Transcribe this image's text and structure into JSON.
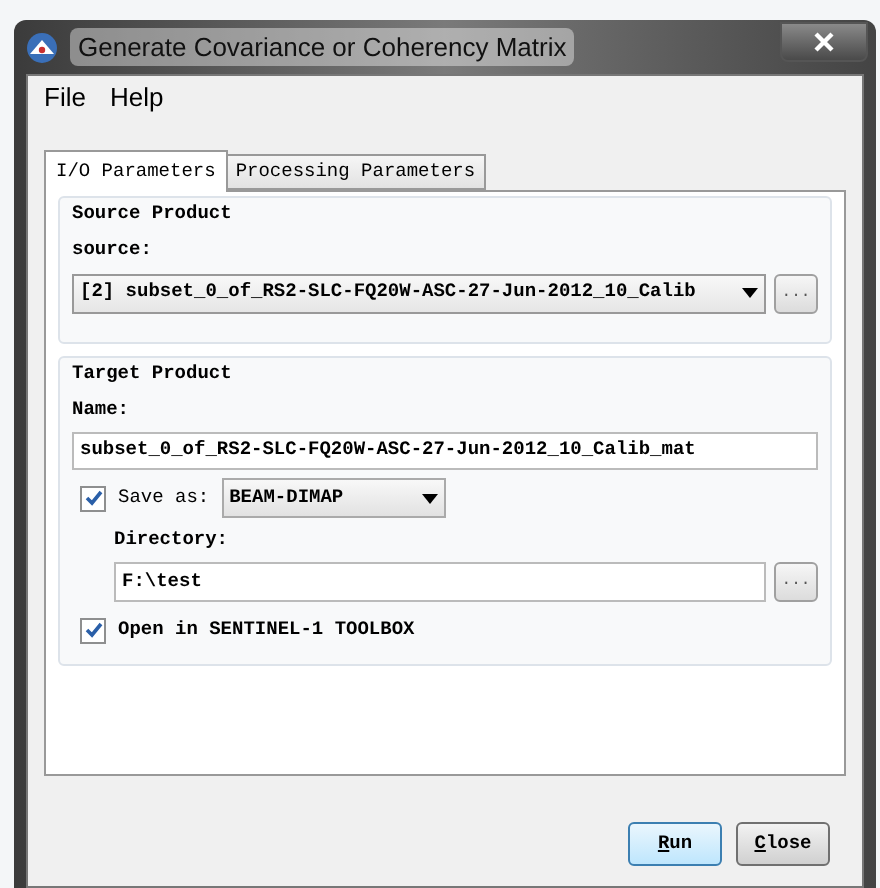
{
  "window": {
    "title": "Generate Covariance or Coherency Matrix"
  },
  "menu": [
    "File",
    "Help"
  ],
  "tabs": [
    {
      "label": "I/O Parameters",
      "selected": true
    },
    {
      "label": "Processing Parameters",
      "selected": false
    }
  ],
  "source_product": {
    "title": "Source Product",
    "label": "source:",
    "value": "[2] subset_0_of_RS2-SLC-FQ20W-ASC-27-Jun-2012_10_Calib",
    "browse": "..."
  },
  "target_product": {
    "title": "Target Product",
    "name_label": "Name:",
    "name_value": "subset_0_of_RS2-SLC-FQ20W-ASC-27-Jun-2012_10_Calib_mat",
    "save_as": {
      "label": "Save as:",
      "checked": true,
      "format": "BEAM-DIMAP"
    },
    "directory_label": "Directory:",
    "directory_value": "F:\\test",
    "browse": "...",
    "open_in": {
      "label": "Open in SENTINEL-1 TOOLBOX",
      "checked": true
    }
  },
  "buttons": [
    {
      "label": "Run",
      "default": true
    },
    {
      "label": "Close",
      "default": false
    }
  ]
}
